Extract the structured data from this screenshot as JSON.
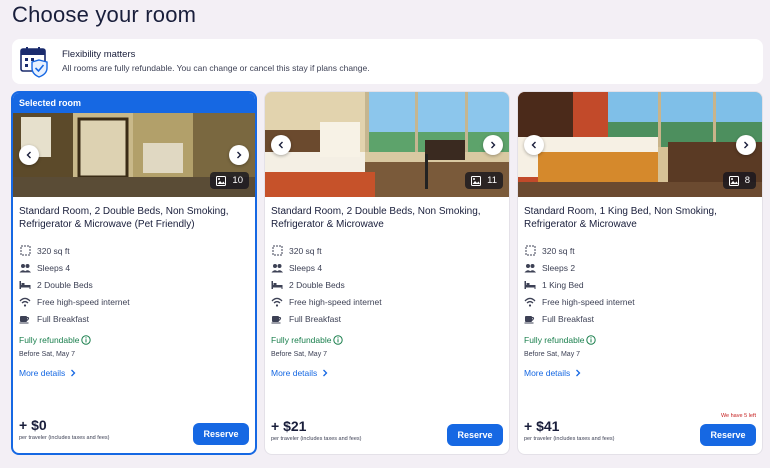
{
  "page_title": "Choose your room",
  "banner": {
    "title": "Flexibility matters",
    "subtitle": "All rooms are fully refundable. You can change or cancel this stay if plans change."
  },
  "cards": [
    {
      "selected_label": "Selected room",
      "title": "Standard Room, 2 Double Beds, Non Smoking, Refrigerator & Microwave (Pet Friendly)",
      "photo_count": "10",
      "features": [
        "320 sq ft",
        "Sleeps 4",
        "2 Double Beds",
        "Free high-speed internet",
        "Full Breakfast"
      ],
      "refund": "Fully refundable",
      "before": "Before Sat, May 7",
      "more": "More details",
      "price": "+ $0",
      "price_note": "per traveler (includes taxes and fees)",
      "reserve": "Reserve",
      "badge": ""
    },
    {
      "selected_label": "",
      "title": "Standard Room, 2 Double Beds, Non Smoking, Refrigerator & Microwave",
      "photo_count": "11",
      "features": [
        "320 sq ft",
        "Sleeps 4",
        "2 Double Beds",
        "Free high-speed internet",
        "Full Breakfast"
      ],
      "refund": "Fully refundable",
      "before": "Before Sat, May 7",
      "more": "More details",
      "price": "+ $21",
      "price_note": "per traveler (includes taxes and fees)",
      "reserve": "Reserve",
      "badge": ""
    },
    {
      "selected_label": "",
      "title": "Standard Room, 1 King Bed, Non Smoking, Refrigerator & Microwave",
      "photo_count": "8",
      "features": [
        "320 sq ft",
        "Sleeps 2",
        "1 King Bed",
        "Free high-speed internet",
        "Full Breakfast"
      ],
      "refund": "Fully refundable",
      "before": "Before Sat, May 7",
      "more": "More details",
      "price": "+ $41",
      "price_note": "per traveler (includes taxes and fees)",
      "reserve": "Reserve",
      "badge": "We have 5 left"
    }
  ],
  "colors": {
    "accent": "#1668e3",
    "refund": "#1a7f4d",
    "warning": "#c51e1e"
  }
}
